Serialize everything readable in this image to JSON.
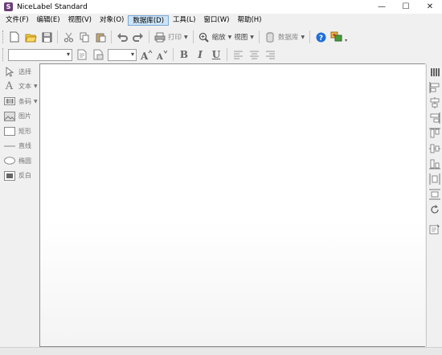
{
  "window": {
    "title": "NiceLabel Standard",
    "icon_letter": "S",
    "minimize": "—",
    "maximize": "☐",
    "close": "✕"
  },
  "menu": [
    {
      "label": "文件(F)"
    },
    {
      "label": "编辑(E)"
    },
    {
      "label": "视图(V)"
    },
    {
      "label": "对象(O)"
    },
    {
      "label": "数据库(D)",
      "active": true
    },
    {
      "label": "工具(L)"
    },
    {
      "label": "窗口(W)"
    },
    {
      "label": "帮助(H)"
    }
  ],
  "toolbar1": {
    "print_label": "打印",
    "zoom_label": "缩放",
    "view_label": "视图",
    "database_label": "数据库"
  },
  "toolbar2": {
    "font_name_value": "",
    "font_size_value": "",
    "bold": "B",
    "italic": "I",
    "underline": "U"
  },
  "left_tools": [
    {
      "label": "选择",
      "icon": "pointer-icon",
      "has_menu": false
    },
    {
      "label": "文本",
      "icon": "text-icon",
      "has_menu": true
    },
    {
      "label": "条码",
      "icon": "barcode-icon",
      "has_menu": true
    },
    {
      "label": "图片",
      "icon": "picture-icon",
      "has_menu": false
    },
    {
      "label": "矩形",
      "icon": "rectangle-icon",
      "has_menu": false
    },
    {
      "label": "直线",
      "icon": "line-icon",
      "has_menu": false
    },
    {
      "label": "椭圆",
      "icon": "ellipse-icon",
      "has_menu": false
    },
    {
      "label": "反白",
      "icon": "inverse-icon",
      "has_menu": false
    }
  ],
  "right_tools": [
    "align-left-icon",
    "align-center-h-icon",
    "align-right-icon",
    "align-top-icon",
    "align-center-v-icon",
    "align-bottom-icon",
    "distribute-h-icon",
    "distribute-v-icon",
    "rotate-icon",
    "properties-icon"
  ],
  "colors": {
    "accent": "#cce4f7",
    "accent_border": "#7aa7d4",
    "app_icon": "#6b3f78",
    "help_blue": "#1e6fd9"
  }
}
